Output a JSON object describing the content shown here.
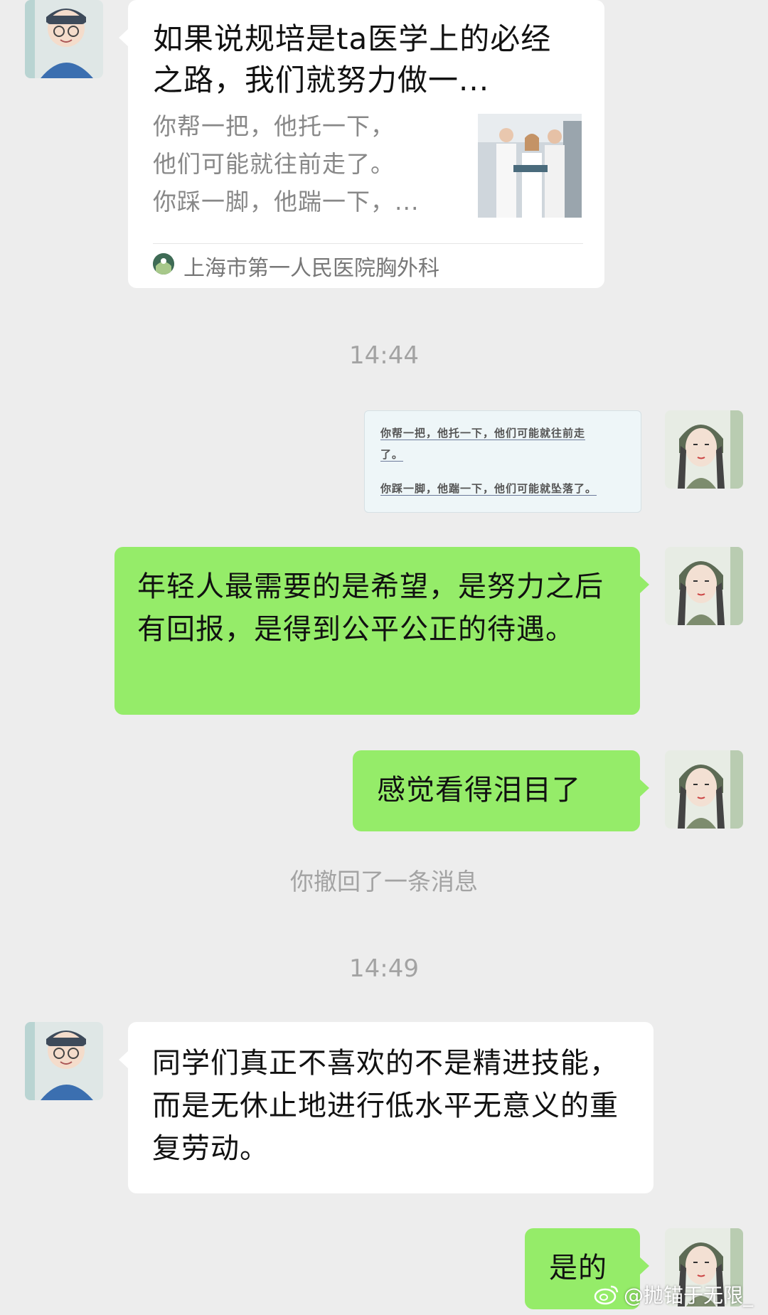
{
  "messages": {
    "card": {
      "title": "如果说规培是ta医学上的必经之路，我们就努力做一...",
      "desc_line1": "你帮一把，他托一下，",
      "desc_line2": "他们可能就往前走了。",
      "desc_line3": "你踩一脚，他踹一下，...",
      "source": "上海市第一人民医院胸外科"
    },
    "time1": "14:44",
    "image_text": {
      "line1": "你帮一把，他托一下，他们可能就往前走",
      "line1b": "了。",
      "line2": "你踩一脚，他踹一下，他们可能就坠落了。"
    },
    "green1": "年轻人最需要的是希望，是努力之后有回报，是得到公平公正的待遇。",
    "green2": "感觉看得泪目了",
    "recalled": "你撤回了一条消息",
    "time2": "14:49",
    "white2": "同学们真正不喜欢的不是精进技能，而是无休止地进行低水平无意义的重复劳动。",
    "green3": "是的"
  },
  "watermark": "@抛锚于无限_",
  "icons": {
    "avatar_left": "avatar-boy-illustration",
    "avatar_right": "avatar-girl-illustration",
    "watermark_logo": "weibo-icon"
  },
  "colors": {
    "background": "#ededed",
    "bubble_green": "#95ec69",
    "bubble_white": "#ffffff"
  }
}
